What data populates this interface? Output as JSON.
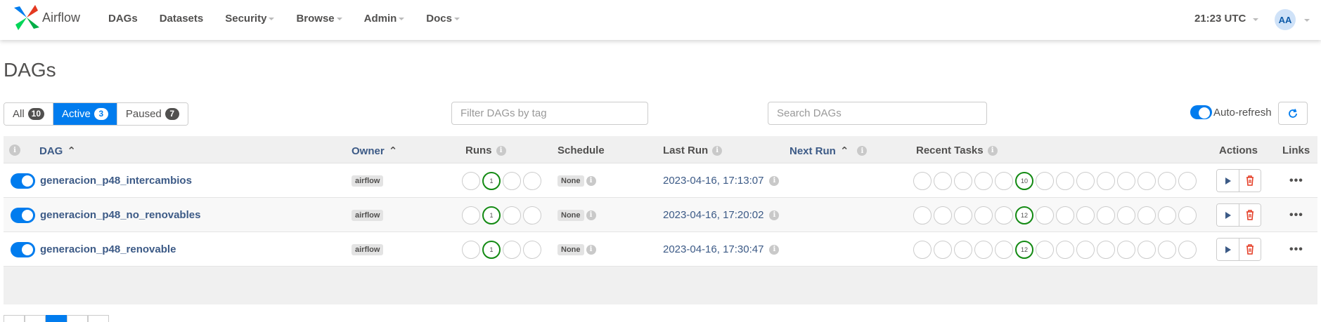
{
  "navbar": {
    "brand": "Airflow",
    "items": [
      {
        "label": "DAGs",
        "dropdown": false
      },
      {
        "label": "Datasets",
        "dropdown": false
      },
      {
        "label": "Security",
        "dropdown": true
      },
      {
        "label": "Browse",
        "dropdown": true
      },
      {
        "label": "Admin",
        "dropdown": true
      },
      {
        "label": "Docs",
        "dropdown": true
      }
    ],
    "clock": "21:23 UTC",
    "avatar": "AA"
  },
  "page": {
    "title": "DAGs"
  },
  "filters": [
    {
      "label": "All",
      "count": "10",
      "active": false
    },
    {
      "label": "Active",
      "count": "3",
      "active": true
    },
    {
      "label": "Paused",
      "count": "7",
      "active": false
    }
  ],
  "tag_filter": {
    "placeholder": "Filter DAGs by tag"
  },
  "search": {
    "placeholder": "Search DAGs"
  },
  "auto_refresh": {
    "label": "Auto-refresh",
    "on": true
  },
  "table": {
    "headers": {
      "dag": "DAG",
      "owner": "Owner",
      "runs": "Runs",
      "schedule": "Schedule",
      "last_run": "Last Run",
      "next_run": "Next Run",
      "recent_tasks": "Recent Tasks",
      "actions": "Actions",
      "links": "Links"
    },
    "rows": [
      {
        "dag_id": "generacion_p48_intercambios",
        "owner": "airflow",
        "runs_success": "1",
        "schedule": "None",
        "last_run": "2023-04-16, 17:13:07",
        "tasks_success": "10",
        "paused": false
      },
      {
        "dag_id": "generacion_p48_no_renovables",
        "owner": "airflow",
        "runs_success": "1",
        "schedule": "None",
        "last_run": "2023-04-16, 17:20:02",
        "tasks_success": "12",
        "paused": false
      },
      {
        "dag_id": "generacion_p48_renovable",
        "owner": "airflow",
        "runs_success": "1",
        "schedule": "None",
        "last_run": "2023-04-16, 17:30:47",
        "tasks_success": "12",
        "paused": false
      }
    ]
  },
  "colors": {
    "accent": "#017cee",
    "success": "#138a13",
    "link": "#3c5a86",
    "delete": "#e43921"
  },
  "icons": [
    "airflow-logo-icon",
    "info-icon",
    "sort-icon",
    "refresh-icon",
    "play-icon",
    "trash-icon",
    "more-icon"
  ]
}
